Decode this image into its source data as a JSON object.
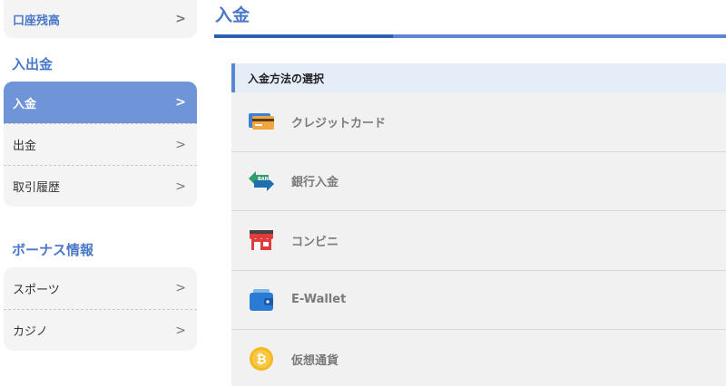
{
  "sidebar": {
    "balance_label": "口座残高",
    "deposit_section_title": "入出金",
    "deposit_items": [
      {
        "label": "入金"
      },
      {
        "label": "出金"
      },
      {
        "label": "取引履歴"
      }
    ],
    "bonus_section_title": "ボーナス情報",
    "bonus_items": [
      {
        "label": "スポーツ"
      },
      {
        "label": "カジノ"
      }
    ],
    "chevron": ">"
  },
  "main": {
    "page_title": "入金",
    "progress_fraction": 0.35,
    "method_header": "入金方法の選択",
    "methods": [
      {
        "label": "クレジットカード",
        "icon": "credit-card-icon"
      },
      {
        "label": "銀行入金",
        "icon": "bank-transfer-icon"
      },
      {
        "label": "コンビニ",
        "icon": "convenience-store-icon"
      },
      {
        "label": "E-Wallet",
        "icon": "e-wallet-icon"
      },
      {
        "label": "仮想通貨",
        "icon": "bitcoin-icon"
      }
    ],
    "bank_icon_text": "BANK"
  },
  "colors": {
    "accent": "#4a78c8",
    "active_row": "#6f95d8",
    "progress_dark": "#2c5fb0",
    "progress_light": "#5a87d5"
  }
}
